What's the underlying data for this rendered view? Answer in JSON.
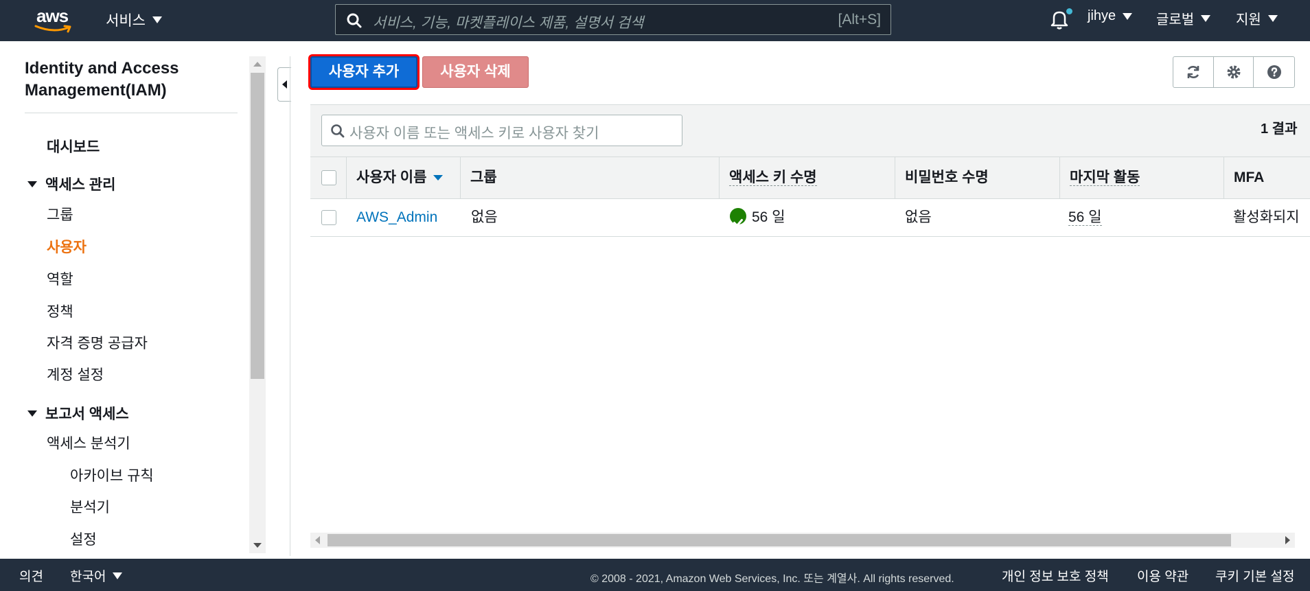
{
  "topnav": {
    "logo_text": "aws",
    "services_label": "서비스",
    "search_placeholder": "서비스, 기능, 마켓플레이스 제품, 설명서 검색",
    "search_shortcut": "[Alt+S]",
    "user_label": "jihye",
    "region_label": "글로벌",
    "support_label": "지원"
  },
  "sidebar": {
    "title": "Identity and Access Management(IAM)",
    "dashboard": "대시보드",
    "section_access": "액세스 관리",
    "items": [
      "그룹",
      "사용자",
      "역할",
      "정책",
      "자격 증명 공급자",
      "계정 설정"
    ],
    "active_item": "사용자",
    "section_reports": "보고서 액세스",
    "report_items": [
      "액세스 분석기"
    ],
    "analyzer_subitems": [
      "아카이브 규칙",
      "분석기",
      "설정"
    ]
  },
  "toolbar": {
    "add_user_label": "사용자 추가",
    "delete_user_label": "사용자 삭제",
    "refresh_icon": "refresh-icon",
    "settings_icon": "gear-icon",
    "help_icon": "help-icon"
  },
  "table": {
    "search_placeholder": "사용자 이름 또는 액세스 키로 사용자 찾기",
    "result_count": "1 결과",
    "columns": [
      "사용자 이름",
      "그룹",
      "액세스 키 수명",
      "비밀번호 수명",
      "마지막 활동",
      "MFA"
    ],
    "rows": [
      {
        "username": "AWS_Admin",
        "groups": "없음",
        "access_key_age": "56 일",
        "password_age": "없음",
        "last_activity": "56 일",
        "mfa": "활성화되지"
      }
    ]
  },
  "footer": {
    "feedback": "의견",
    "language": "한국어",
    "copyright": "© 2008 - 2021, Amazon Web Services, Inc. 또는 계열사. All rights reserved.",
    "privacy": "개인 정보 보호 정책",
    "terms": "이용 약관",
    "cookies": "쿠키 기본 설정"
  },
  "colors": {
    "nav_bg": "#232f3e",
    "primary_button": "#0f6cd6",
    "danger_button_disabled": "#e08a8a",
    "active_nav": "#ec7211",
    "link": "#0073bb",
    "success": "#1d8102",
    "highlight_border": "#ff0000"
  }
}
